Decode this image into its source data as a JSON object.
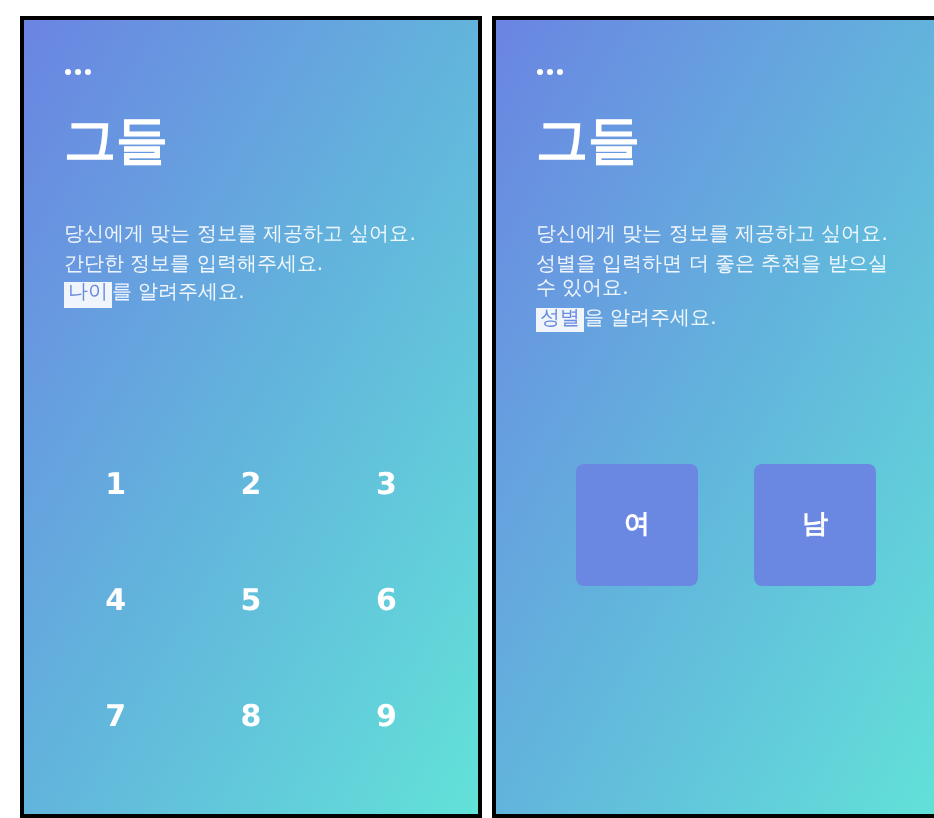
{
  "screens": [
    {
      "kind": "keypad",
      "title": "그들",
      "lines": [
        "당신에게 맞는 정보를 제공하고 싶어요.",
        "간단한 정보를 입력해주세요."
      ],
      "highlight": "나이",
      "prompt": "를 알려주세요.",
      "keys": [
        "1",
        "2",
        "3",
        "4",
        "5",
        "6",
        "7",
        "8",
        "9"
      ]
    },
    {
      "kind": "choices",
      "title": "그들",
      "lines": [
        "당신에게 맞는 정보를 제공하고 싶어요.",
        "성별을 입력하면 더 좋은 추천을 받으실 수 있어요."
      ],
      "highlight": "성별",
      "prompt": "을 알려주세요.",
      "keys": [
        "여",
        "남"
      ]
    }
  ]
}
